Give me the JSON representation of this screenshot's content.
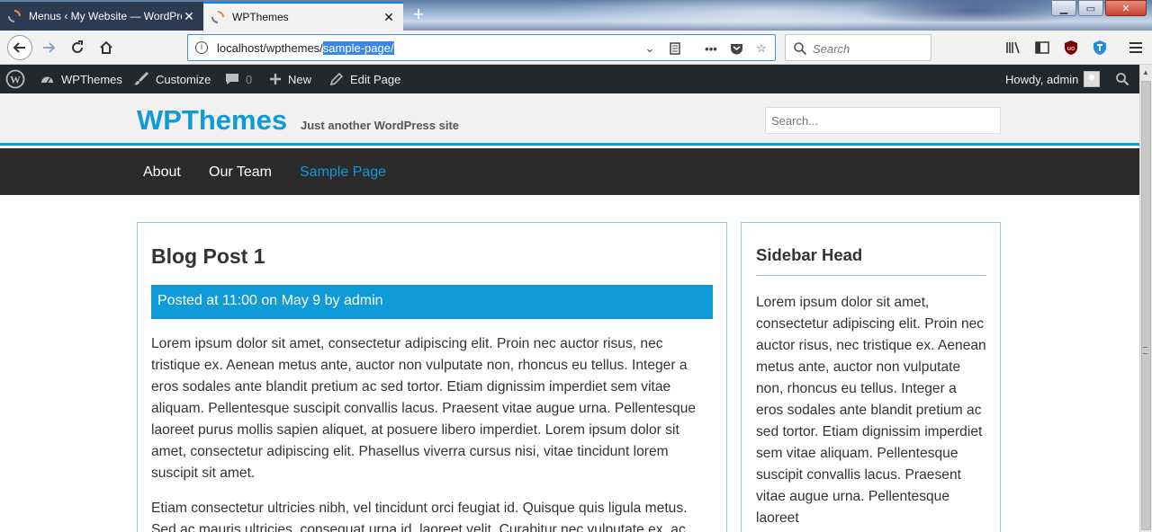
{
  "browser": {
    "tabs": [
      {
        "title": "Menus ‹ My Website — WordPress",
        "active": false
      },
      {
        "title": "WPThemes",
        "active": true
      }
    ],
    "url_plain": "localhost/wpthemes/",
    "url_selected": "sample-page/",
    "search_placeholder": "Search"
  },
  "admin_bar": {
    "site_name": "WPThemes",
    "customize": "Customize",
    "comments_count": "0",
    "new": "New",
    "edit_page": "Edit Page",
    "greeting": "Howdy, admin"
  },
  "site": {
    "title": "WPThemes",
    "tagline": "Just another WordPress site",
    "search_placeholder": "Search...",
    "accent_color": "#0f9ad8",
    "nav": [
      {
        "label": "About"
      },
      {
        "label": "Our Team"
      },
      {
        "label": "Sample Page",
        "current": true
      }
    ]
  },
  "post": {
    "title": "Blog Post 1",
    "meta": "Posted at 11:00 on May 9 by admin",
    "paragraphs": [
      "Lorem ipsum dolor sit amet, consectetur adipiscing elit. Proin nec auctor risus, nec tristique ex. Aenean metus ante, auctor non vulputate non, rhoncus eu tellus. Integer a eros sodales ante blandit pretium ac sed tortor. Etiam dignissim imperdiet sem vitae aliquam. Pellentesque suscipit convallis lacus. Praesent vitae augue urna. Pellentesque laoreet purus mollis sapien aliquet, at posuere libero imperdiet. Lorem ipsum dolor sit amet, consectetur adipiscing elit. Phasellus viverra cursus nisi, vitae tincidunt lorem suscipit sit amet.",
      "Etiam consectetur ultricies nibh, vel tincidunt orci feugiat id. Quisque quis ligula metus. Sed ac mauris ultricies, consequat urna id, laoreet velit. Curabitur nec vulputate ex, ac"
    ]
  },
  "sidebar": {
    "heading": "Sidebar Head",
    "text": "Lorem ipsum dolor sit amet, consectetur adipiscing elit. Proin nec auctor risus, nec tristique ex. Aenean metus ante, auctor non vulputate non, rhoncus eu tellus. Integer a eros sodales ante blandit pretium ac sed tortor. Etiam dignissim imperdiet sem vitae aliquam. Pellentesque suscipit convallis lacus. Praesent vitae augue urna. Pellentesque laoreet"
  }
}
